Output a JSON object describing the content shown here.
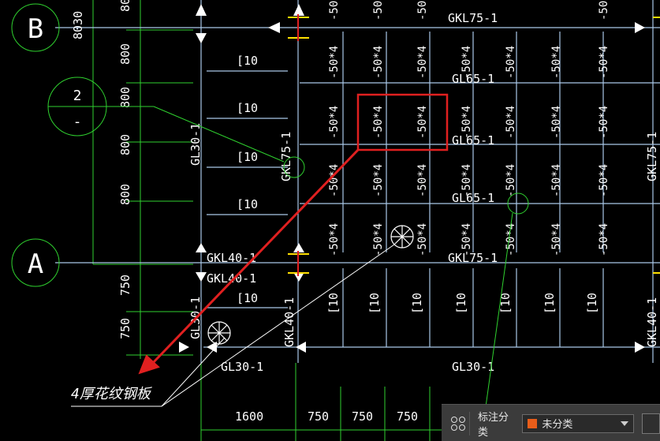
{
  "drawing": {
    "axis_b": "B",
    "axis_a": "A",
    "section_top": "2",
    "section_bottom": "-",
    "left_dims": [
      "8030",
      "800",
      "800",
      "800",
      "800",
      "800",
      "750",
      "750"
    ],
    "bottom_dims": [
      "1600",
      "750",
      "750",
      "750"
    ],
    "channel_label": "[10",
    "angle_label": "-50*4",
    "beam_gkl75": "GKL75-1",
    "beam_gl65": "GL65-1",
    "beam_gkl40": "GKL40-1",
    "beam_gl30": "GL30-1",
    "col_gl30": "GL30-1",
    "col_gkl75": "GKL75-1",
    "col_gkl40": "GKL40-1",
    "leader_note": "4厚花纹钢板"
  },
  "toolbar": {
    "icon": "grid-icon",
    "label": "标注分类",
    "select_value": "未分类",
    "select_swatch_color": "#e85d1a",
    "edit_icon": "edit-icon"
  },
  "colors": {
    "background": "#000000",
    "grid_line": "#a9c8e8",
    "dim_green": "#2fd12f",
    "text_white": "#ffffff",
    "highlight_red": "#e02020",
    "column_yellow": "#ffe000"
  }
}
